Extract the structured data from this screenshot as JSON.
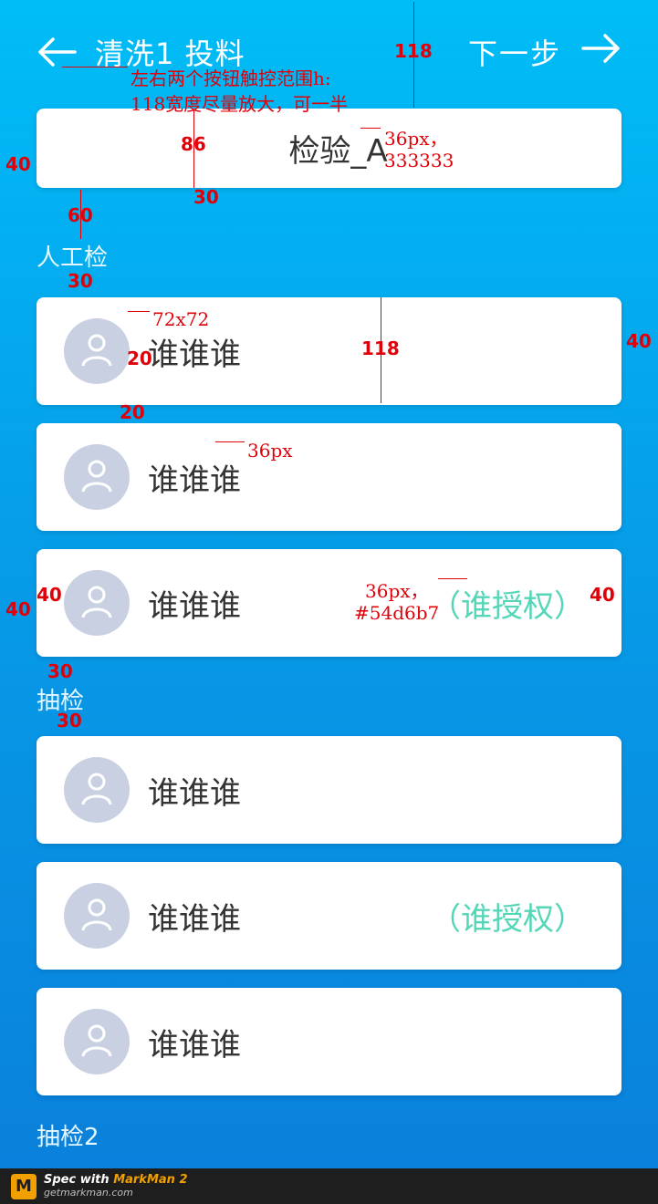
{
  "header": {
    "title": "清洗1  投料",
    "next_label": "下一步"
  },
  "step": {
    "value": "检验_A"
  },
  "groups": [
    {
      "label": "人工检"
    },
    {
      "label": "抽检"
    },
    {
      "label": "抽检2"
    }
  ],
  "people": [
    {
      "name": "谁谁谁",
      "tag": ""
    },
    {
      "name": "谁谁谁",
      "tag": ""
    },
    {
      "name": "谁谁谁",
      "tag": "（谁授权）"
    },
    {
      "name": "谁谁谁",
      "tag": ""
    },
    {
      "name": "谁谁谁",
      "tag": "（谁授权）"
    },
    {
      "name": "谁谁谁",
      "tag": ""
    }
  ],
  "annotations": {
    "header_note_1": "左右两个按钮触控范围h:",
    "header_note_2": "118宽度尽量放大，可一半",
    "h118_top": "118",
    "h86": "86",
    "font_36": "36px，",
    "color_333": "333333",
    "m40_left": "40",
    "m30": "30",
    "m60": "60",
    "m30_b": "30",
    "avatar_size": "72x72",
    "gap20": "20",
    "h118_card": "118",
    "m40_right": "40",
    "gap20_b": "20",
    "font_36_b": "36px",
    "m40_c": "40",
    "m40_d": "40",
    "font_36_c": "36px，",
    "color_auth": "#54d6b7",
    "m40_e": "40",
    "m30_c": "30",
    "m30_d": "30"
  },
  "colors": {
    "text_primary": "#333333",
    "auth": "#54d6b7",
    "bg_top": "#00bdf7",
    "bg_bottom": "#0a7fdb",
    "annotation": "#e0000a"
  },
  "markman": {
    "line1_prefix": "Spec with ",
    "line1_brand": "MarkMan 2",
    "line2": "getmarkman.com"
  }
}
